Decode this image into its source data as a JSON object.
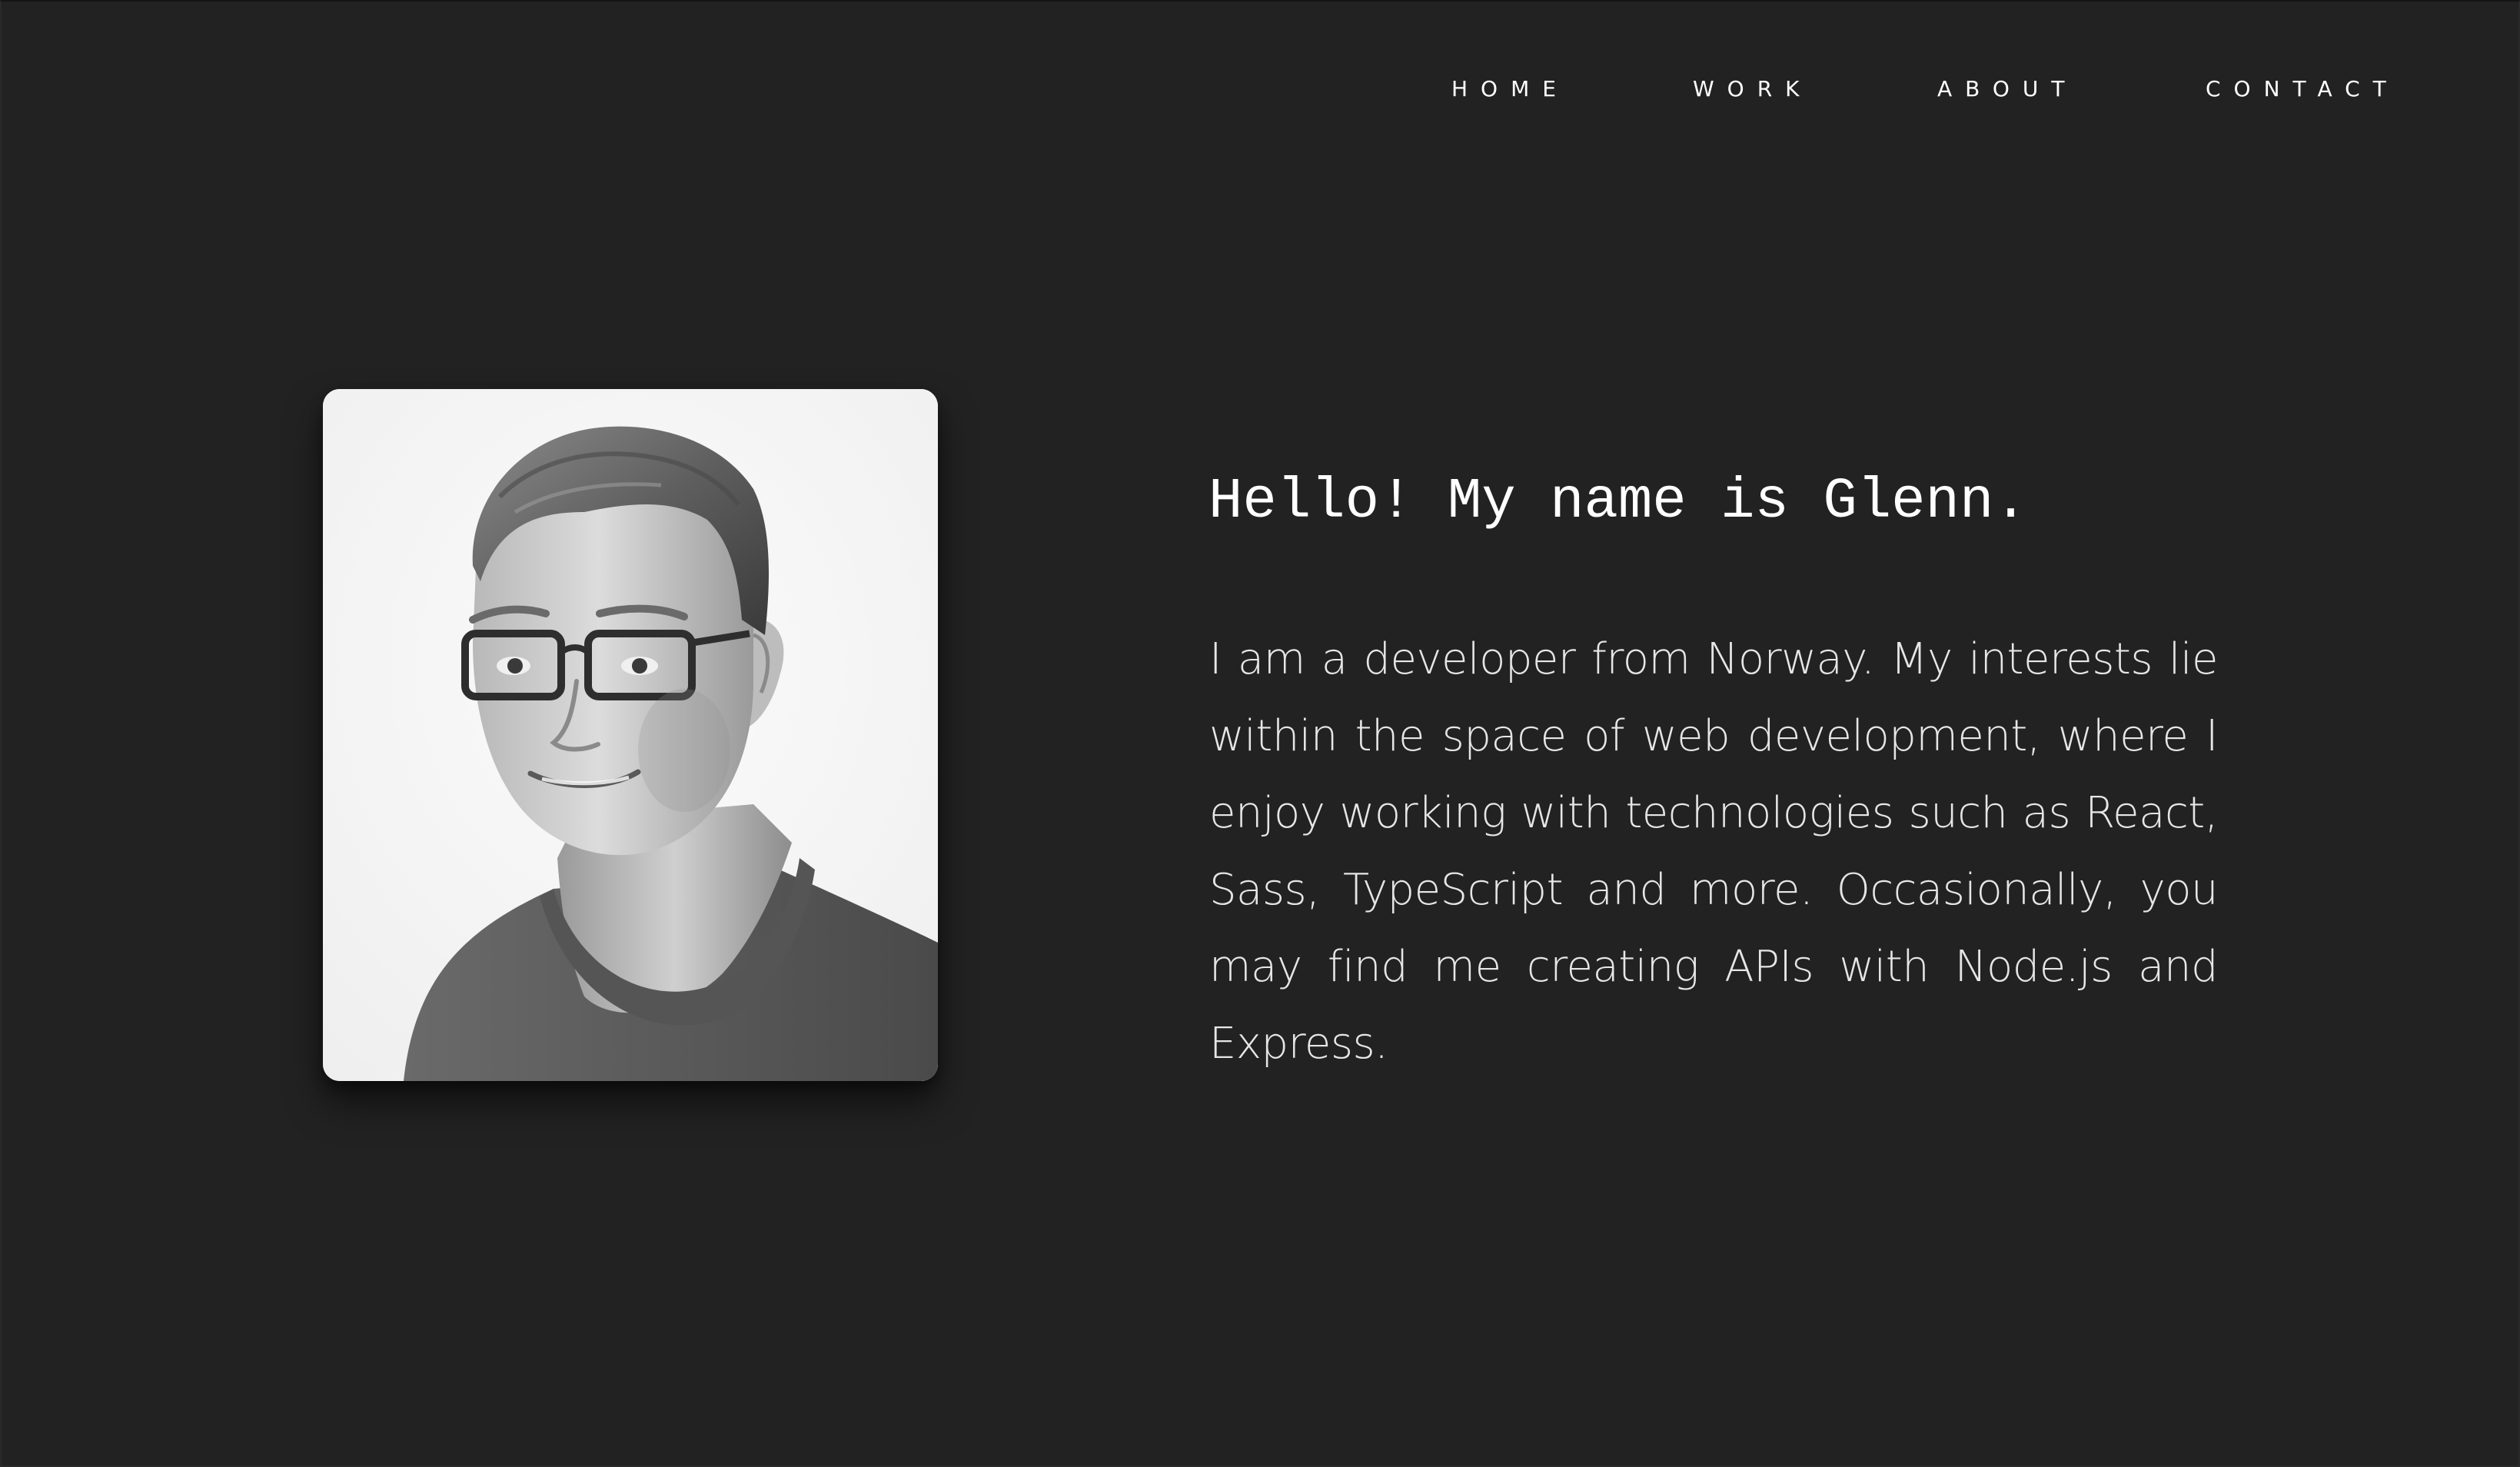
{
  "nav": {
    "items": [
      {
        "label": "HOME"
      },
      {
        "label": "WORK"
      },
      {
        "label": "ABOUT"
      },
      {
        "label": "CONTACT"
      }
    ]
  },
  "hero": {
    "heading": "Hello! My name is Glenn.",
    "intro": "I am a developer from Norway. My interests lie within the space of web development, where I enjoy working with technologies such as React, Sass, TypeScript and more. Occasionally, you may find me creating APIs with Node.js and Express.",
    "photo": {
      "icon": "portrait-photo",
      "description_style": "black-and-white"
    }
  },
  "colors": {
    "background": "#222222",
    "text": "#ffffff",
    "body_text": "#e6e6e6"
  }
}
